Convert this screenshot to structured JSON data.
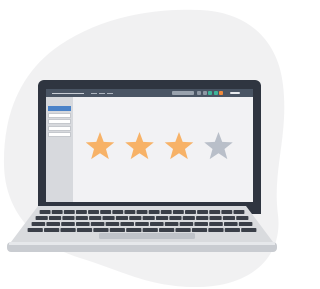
{
  "illustration": {
    "subject": "laptop-rating-screen",
    "colors": {
      "backdrop_blob": "#f1f1f2",
      "bezel": "#2f3540",
      "topbar": "#4a5564",
      "sidebar": "#d7d9dd",
      "sidebar_active": "#4a82c8",
      "content": "#f2f2f4",
      "star_filled": "#f7b267",
      "star_empty": "#b9bfc9",
      "keyboard_deck": "#d9dbde",
      "key": "#3a3f48",
      "trackpad": "#bfc3c9"
    },
    "topbar_buttons": [
      {
        "name": "toolbar-gray-button-1",
        "color": "#8f98a4"
      },
      {
        "name": "toolbar-gray-button-2",
        "color": "#8f98a4"
      },
      {
        "name": "toolbar-green-button-1",
        "color": "#3fb59a"
      },
      {
        "name": "toolbar-green-button-2",
        "color": "#3fb59a"
      },
      {
        "name": "toolbar-orange-button",
        "color": "#f08a3c"
      }
    ],
    "sidebar_items": [
      {
        "active": true
      },
      {
        "active": false
      },
      {
        "active": false
      },
      {
        "active": false
      },
      {
        "active": false
      }
    ],
    "rating": {
      "value": 3,
      "max": 4
    }
  }
}
